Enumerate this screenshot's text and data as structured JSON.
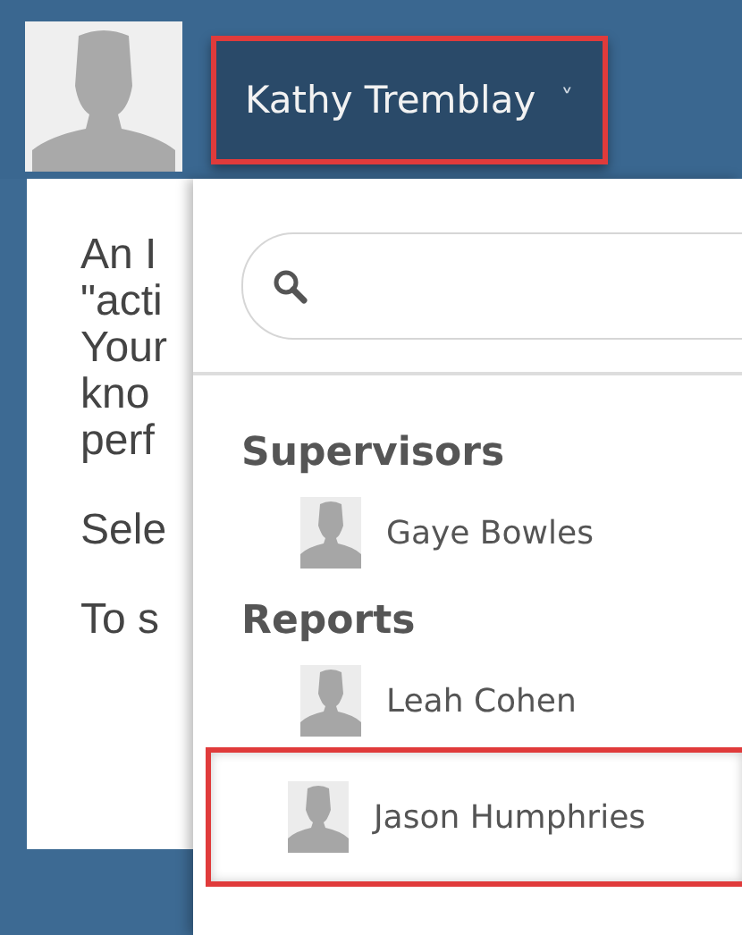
{
  "header": {
    "user_button": {
      "label": "Kathy Tremblay",
      "caret": "˅",
      "highlighted": true
    }
  },
  "background_paragraphs": [
    [
      "An I",
      "\"acti",
      "Your",
      "kno",
      "perf"
    ],
    [
      "Sele"
    ],
    [
      "To s"
    ]
  ],
  "dropdown": {
    "groups": [
      {
        "heading": "Supervisors",
        "people": [
          {
            "name": "Gaye Bowles",
            "highlighted": false
          }
        ]
      },
      {
        "heading": "Reports",
        "people": [
          {
            "name": "Leah Cohen",
            "highlighted": false
          },
          {
            "name": "Jason Humphries",
            "highlighted": true
          }
        ]
      }
    ]
  }
}
